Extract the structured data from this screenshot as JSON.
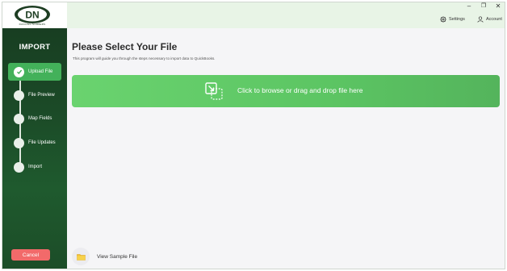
{
  "brand": {
    "logo_text": "DN",
    "tagline": "DANCING NUMBERS",
    "primary": "#1b4a27",
    "accent": "#43b15a",
    "danger": "#f26a6a"
  },
  "sidebar": {
    "title": "IMPORT",
    "steps": [
      {
        "label": "Upload File",
        "active": true
      },
      {
        "label": "File Preview",
        "active": false
      },
      {
        "label": "Map Fields",
        "active": false
      },
      {
        "label": "File Updates",
        "active": false
      },
      {
        "label": "Import",
        "active": false
      }
    ],
    "cancel_label": "Cancel"
  },
  "window_controls": {
    "minimize": "–",
    "restore": "❐",
    "close": "✕"
  },
  "topbar": {
    "settings_label": "Settings",
    "account_label": "Account"
  },
  "main": {
    "title": "Please Select Your File",
    "subtitle": "This program will guide you through the steps necessary to import data to QuickBooks.",
    "dropzone_label": "Click to browse or drag and drop file here",
    "sample_label": "View Sample File"
  }
}
